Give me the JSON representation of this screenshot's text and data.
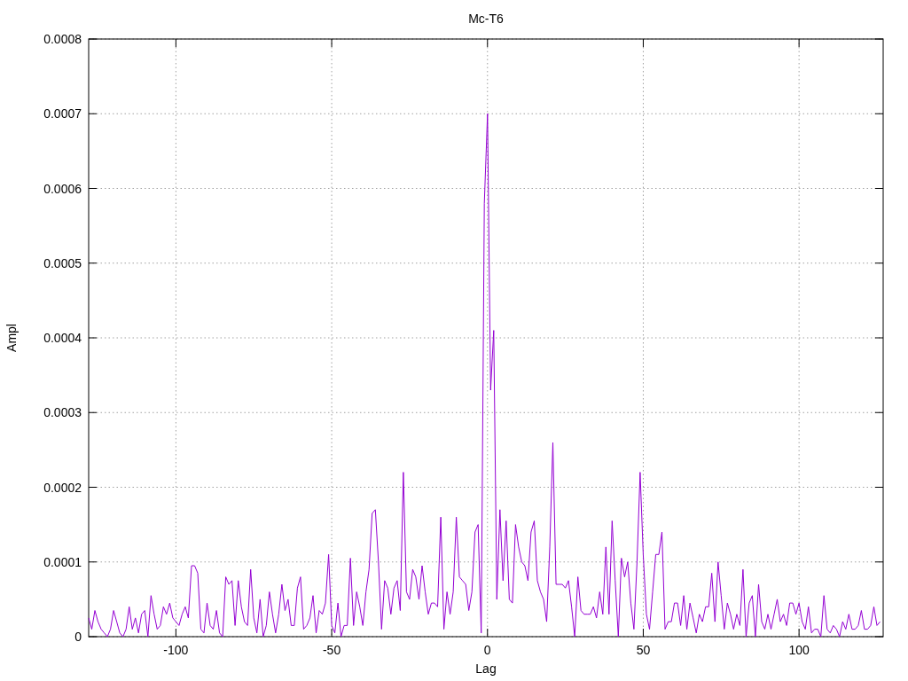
{
  "chart_data": {
    "type": "line",
    "title": "Mc-T6",
    "xlabel": "Lag",
    "ylabel": "Ampl",
    "xlim": [
      -128,
      127
    ],
    "ylim": [
      0,
      0.0008
    ],
    "xticks": [
      -100,
      -50,
      0,
      50,
      100
    ],
    "yticks": [
      {
        "value": 0,
        "label": "0"
      },
      {
        "value": 0.0001,
        "label": "0.0001"
      },
      {
        "value": 0.0002,
        "label": "0.0002"
      },
      {
        "value": 0.0003,
        "label": "0.0003"
      },
      {
        "value": 0.0004,
        "label": "0.0004"
      },
      {
        "value": 0.0005,
        "label": "0.0005"
      },
      {
        "value": 0.0006,
        "label": "0.0006"
      },
      {
        "value": 0.0007,
        "label": "0.0007"
      },
      {
        "value": 0.0008,
        "label": "0.0008"
      }
    ],
    "x": [
      -128,
      -127,
      -126,
      -125,
      -124,
      -123,
      -122,
      -121,
      -120,
      -119,
      -118,
      -117,
      -116,
      -115,
      -114,
      -113,
      -112,
      -111,
      -110,
      -109,
      -108,
      -107,
      -106,
      -105,
      -104,
      -103,
      -102,
      -101,
      -100,
      -99,
      -98,
      -97,
      -96,
      -95,
      -94,
      -93,
      -92,
      -91,
      -90,
      -89,
      -88,
      -87,
      -86,
      -85,
      -84,
      -83,
      -82,
      -81,
      -80,
      -79,
      -78,
      -77,
      -76,
      -75,
      -74,
      -73,
      -72,
      -71,
      -70,
      -69,
      -68,
      -67,
      -66,
      -65,
      -64,
      -63,
      -62,
      -61,
      -60,
      -59,
      -58,
      -57,
      -56,
      -55,
      -54,
      -53,
      -52,
      -51,
      -50,
      -49,
      -48,
      -47,
      -46,
      -45,
      -44,
      -43,
      -42,
      -41,
      -40,
      -39,
      -38,
      -37,
      -36,
      -35,
      -34,
      -33,
      -32,
      -31,
      -30,
      -29,
      -28,
      -27,
      -26,
      -25,
      -24,
      -23,
      -22,
      -21,
      -20,
      -19,
      -18,
      -17,
      -16,
      -15,
      -14,
      -13,
      -12,
      -11,
      -10,
      -9,
      -8,
      -7,
      -6,
      -5,
      -4,
      -3,
      -2,
      -1,
      0,
      1,
      2,
      3,
      4,
      5,
      6,
      7,
      8,
      9,
      10,
      11,
      12,
      13,
      14,
      15,
      16,
      17,
      18,
      19,
      20,
      21,
      22,
      23,
      24,
      25,
      26,
      27,
      28,
      29,
      30,
      31,
      32,
      33,
      34,
      35,
      36,
      37,
      38,
      39,
      40,
      41,
      42,
      43,
      44,
      45,
      46,
      47,
      48,
      49,
      50,
      51,
      52,
      53,
      54,
      55,
      56,
      57,
      58,
      59,
      60,
      61,
      62,
      63,
      64,
      65,
      66,
      67,
      68,
      69,
      70,
      71,
      72,
      73,
      74,
      75,
      76,
      77,
      78,
      79,
      80,
      81,
      82,
      83,
      84,
      85,
      86,
      87,
      88,
      89,
      90,
      91,
      92,
      93,
      94,
      95,
      96,
      97,
      98,
      99,
      100,
      101,
      102,
      103,
      104,
      105,
      106,
      107,
      108,
      109,
      110,
      111,
      112,
      113,
      114,
      115,
      116,
      117,
      118,
      119,
      120,
      121,
      122,
      123,
      124,
      125,
      126
    ],
    "grid": true,
    "series": [
      {
        "color": "#9400d3",
        "values": [
          2.5e-05,
          1e-05,
          3.5e-05,
          2e-05,
          1e-05,
          5e-06,
          0,
          1e-05,
          3.5e-05,
          2e-05,
          5e-06,
          0,
          1e-05,
          4e-05,
          1e-05,
          2.5e-05,
          5e-06,
          3e-05,
          3.5e-05,
          0,
          5.5e-05,
          3e-05,
          1e-05,
          1.5e-05,
          4e-05,
          3e-05,
          4.5e-05,
          2.5e-05,
          2e-05,
          1.5e-05,
          3e-05,
          4e-05,
          2.5e-05,
          9.5e-05,
          9.5e-05,
          8.5e-05,
          1e-05,
          5e-06,
          4.5e-05,
          1.5e-05,
          1e-05,
          3.5e-05,
          5e-06,
          0,
          8e-05,
          7e-05,
          7.5e-05,
          1.5e-05,
          7.5e-05,
          4e-05,
          2e-05,
          1.5e-05,
          9e-05,
          2.5e-05,
          5e-06,
          5e-05,
          0,
          1.5e-05,
          6e-05,
          3e-05,
          5e-06,
          3e-05,
          7e-05,
          3.5e-05,
          5e-05,
          1.5e-05,
          1.5e-05,
          6.5e-05,
          8e-05,
          1e-05,
          1.5e-05,
          2.5e-05,
          5.5e-05,
          5e-06,
          3.5e-05,
          3e-05,
          4.5e-05,
          0.00011,
          1.5e-05,
          5e-06,
          4.5e-05,
          0,
          1.5e-05,
          1.5e-05,
          0.000105,
          1.5e-05,
          6e-05,
          4e-05,
          1.5e-05,
          6e-05,
          9e-05,
          0.000165,
          0.00017,
          0.0001,
          1e-05,
          7.5e-05,
          6.5e-05,
          3e-05,
          6.5e-05,
          7.5e-05,
          3.5e-05,
          0.00022,
          6e-05,
          5e-05,
          9e-05,
          8e-05,
          5e-05,
          9.5e-05,
          6e-05,
          3e-05,
          4.5e-05,
          4.5e-05,
          4e-05,
          0.00016,
          1e-05,
          6e-05,
          3e-05,
          6e-05,
          0.00016,
          8e-05,
          7.5e-05,
          7e-05,
          3.5e-05,
          6e-05,
          0.00014,
          0.00015,
          5e-06,
          0.00058,
          0.0007,
          0.00033,
          0.00041,
          5e-05,
          0.00017,
          7.5e-05,
          0.000155,
          5e-05,
          4.5e-05,
          0.00015,
          0.00012,
          0.0001,
          9.5e-05,
          7.5e-05,
          0.00014,
          0.000155,
          7.5e-05,
          6e-05,
          5e-05,
          2e-05,
          0.00012,
          0.00026,
          7e-05,
          7e-05,
          7e-05,
          6.5e-05,
          7.5e-05,
          4e-05,
          0,
          8e-05,
          3.5e-05,
          3e-05,
          3e-05,
          3e-05,
          4e-05,
          2.5e-05,
          6e-05,
          3e-05,
          0.00012,
          3e-05,
          0.000155,
          7.5e-05,
          0,
          0.000105,
          8e-05,
          0.0001,
          4.5e-05,
          1e-05,
          0.0001,
          0.00022,
          0.00011,
          3e-05,
          1e-05,
          6e-05,
          0.00011,
          0.00011,
          0.00014,
          1e-05,
          2e-05,
          2e-05,
          4.5e-05,
          4.5e-05,
          1.5e-05,
          5.5e-05,
          1e-05,
          4.5e-05,
          2.5e-05,
          5e-06,
          3e-05,
          2e-05,
          4e-05,
          4e-05,
          8.5e-05,
          2e-05,
          0.0001,
          5.5e-05,
          1e-05,
          4.5e-05,
          3e-05,
          1e-05,
          3e-05,
          1.5e-05,
          9e-05,
          0,
          4.5e-05,
          5.5e-05,
          0,
          7e-05,
          2e-05,
          1e-05,
          3e-05,
          1e-05,
          3e-05,
          5e-05,
          2e-05,
          3e-05,
          1.5e-05,
          4.5e-05,
          4.5e-05,
          3e-05,
          4.5e-05,
          2e-05,
          1e-05,
          4e-05,
          5e-06,
          1e-05,
          1e-05,
          0,
          5.5e-05,
          1e-05,
          5e-06,
          1.5e-05,
          1e-05,
          0,
          2e-05,
          1e-05,
          3e-05,
          1e-05,
          1e-05,
          1.5e-05,
          3.5e-05,
          1e-05,
          1e-05,
          1.5e-05,
          4e-05,
          1.5e-05,
          2e-05
        ]
      }
    ]
  }
}
